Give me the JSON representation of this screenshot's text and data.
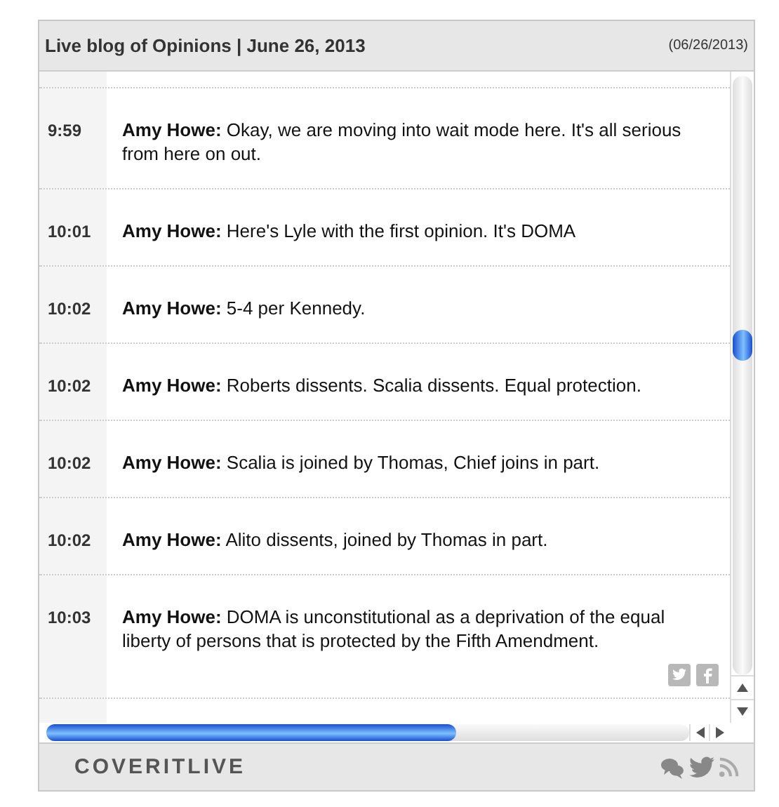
{
  "header": {
    "title": "Live blog of Opinions | June 26, 2013",
    "date": "(06/26/2013)"
  },
  "entries": [
    {
      "time": "9:59",
      "author": "Amy Howe:",
      "text": "Okay, we are moving into wait mode here. It's all serious from here on out.",
      "share": false
    },
    {
      "time": "10:01",
      "author": "Amy Howe:",
      "text": "Here's Lyle with the first opinion. It's DOMA",
      "share": false
    },
    {
      "time": "10:02",
      "author": "Amy Howe:",
      "text": "5-4 per Kennedy.",
      "share": false
    },
    {
      "time": "10:02",
      "author": "Amy Howe:",
      "text": "Roberts dissents. Scalia dissents. Equal protection.",
      "share": false
    },
    {
      "time": "10:02",
      "author": "Amy Howe:",
      "text": "Scalia is joined by Thomas, Chief joins in part.",
      "share": false
    },
    {
      "time": "10:02",
      "author": "Amy Howe:",
      "text": "Alito dissents, joined by Thomas in part.",
      "share": false
    },
    {
      "time": "10:03",
      "author": "Amy Howe:",
      "text": "DOMA is unconstitutional as a deprivation of the equal liberty of persons that is protected by the Fifth Amendment.",
      "share": true
    }
  ],
  "footer": {
    "logo": "COVERITLIVE"
  }
}
